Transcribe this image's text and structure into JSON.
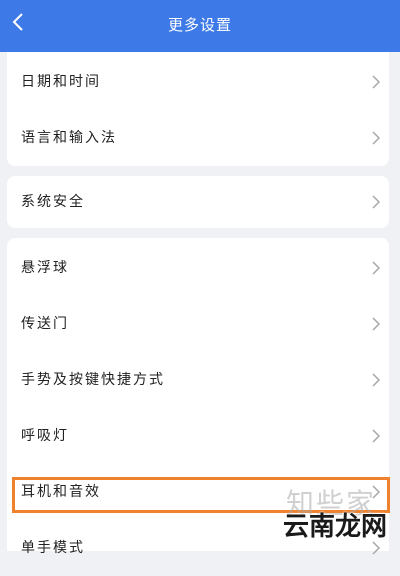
{
  "header": {
    "title": "更多设置"
  },
  "groups": [
    [
      "日期和时间",
      "语言和输入法"
    ],
    [
      "系统安全"
    ],
    [
      "悬浮球",
      "传送门",
      "手势及按键快捷方式",
      "呼吸灯",
      "耳机和音效",
      "单手模式"
    ]
  ],
  "highlighted_item": "耳机和音效",
  "watermark": {
    "light": "知些家",
    "dark": "云南龙网"
  },
  "colors": {
    "header_bg": "#3d7ae7",
    "highlight_border": "#f0822d",
    "page_bg": "#f0f1f5"
  },
  "icons": {
    "back": "chevron-left-icon",
    "row": "chevron-right-icon"
  }
}
